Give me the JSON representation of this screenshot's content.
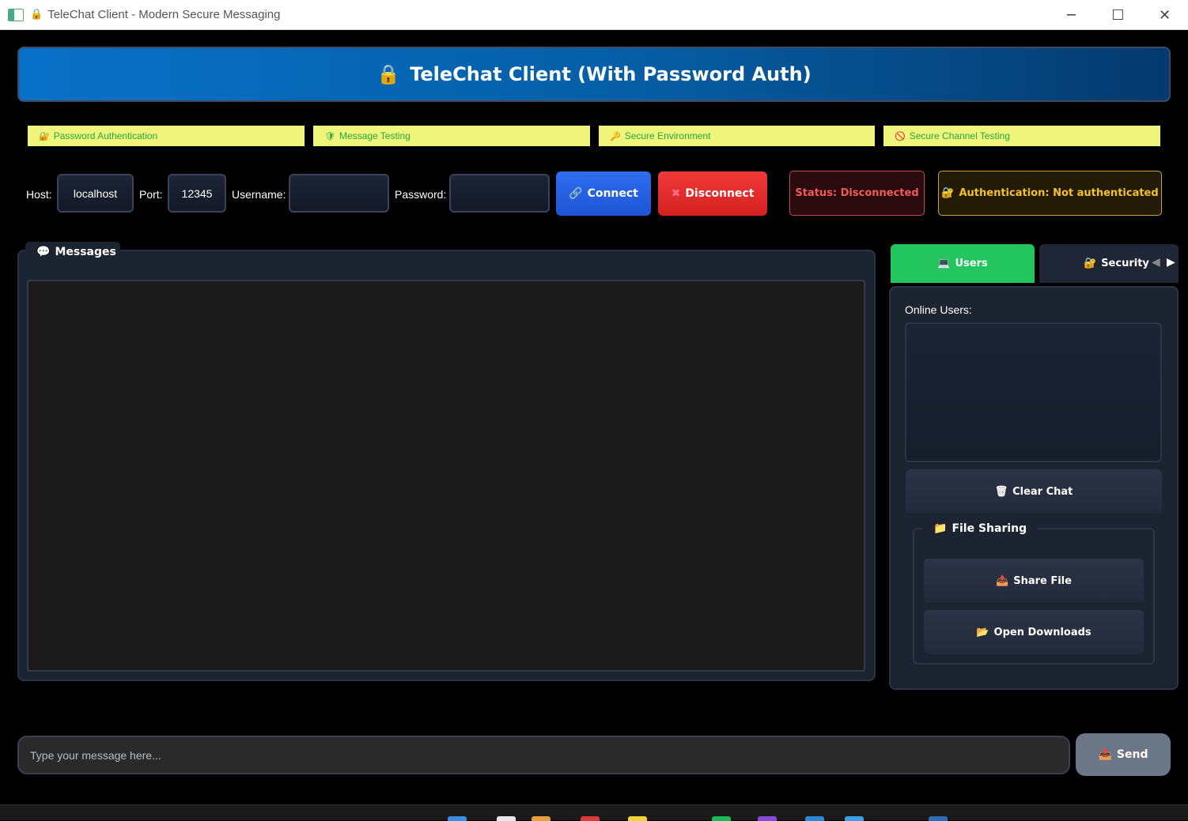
{
  "window": {
    "title": "TeleChat Client - Modern Secure Messaging",
    "minimize": "─",
    "maximize": "☐",
    "close": "✕"
  },
  "header": {
    "title": "TeleChat Client (With Password Auth)",
    "icon": "lock-icon"
  },
  "features": [
    {
      "icon": "🔐",
      "label": "Password Authentication"
    },
    {
      "icon": "🛡",
      "label": "Message Testing"
    },
    {
      "icon": "🔑",
      "label": "Secure Environment"
    },
    {
      "icon": "🚫",
      "label": "Secure Channel Testing"
    }
  ],
  "connection": {
    "host_label": "Host:",
    "host_value": "localhost",
    "port_label": "Port:",
    "port_value": "12345",
    "username_label": "Username:",
    "username_value": "",
    "password_label": "Password:",
    "password_value": "",
    "connect_label": "Connect",
    "disconnect_label": "Disconnect",
    "status_text": "Status: Disconnected",
    "auth_text": "Authentication: Not authenticated"
  },
  "messages": {
    "tab_label": "Messages"
  },
  "side": {
    "tabs": [
      {
        "icon": "💻",
        "label": "Users"
      },
      {
        "icon": "🔐",
        "label": "Security"
      }
    ],
    "online_users_label": "Online Users:",
    "clear_chat_label": "Clear Chat",
    "file_sharing_title": "File Sharing",
    "share_file_label": "Share File",
    "open_downloads_label": "Open Downloads"
  },
  "composer": {
    "placeholder": "Type your message here...",
    "send_label": "Send"
  },
  "colors": {
    "accent_blue": "#2f6df0",
    "danger_red": "#f03a3a",
    "success_green": "#22c55e",
    "warning_yellow": "#f5c12a",
    "feature_bg": "#eef57a"
  }
}
